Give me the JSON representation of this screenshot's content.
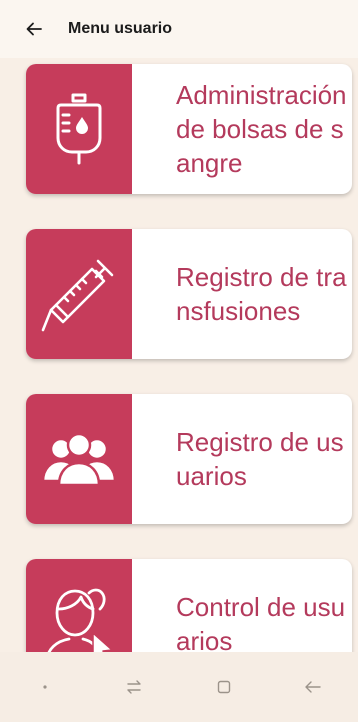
{
  "app_bar": {
    "title": "Menu usuario",
    "back_icon": "arrow-left-icon"
  },
  "menu": {
    "items": [
      {
        "label": "Administración de bolsas de sangre",
        "icon": "blood-bag-icon"
      },
      {
        "label": "Registro de transfusiones",
        "icon": "syringe-icon"
      },
      {
        "label": "Registro de usuarios",
        "icon": "users-icon"
      },
      {
        "label": "Control de usuarios",
        "icon": "user-select-icon"
      }
    ]
  },
  "nav_bar": {
    "buttons": [
      "dot-icon",
      "recent-apps-icon",
      "home-icon",
      "back-icon"
    ]
  },
  "colors": {
    "accent": "#c63c5b",
    "label": "#b43a5c",
    "background": "#f8efe6"
  }
}
